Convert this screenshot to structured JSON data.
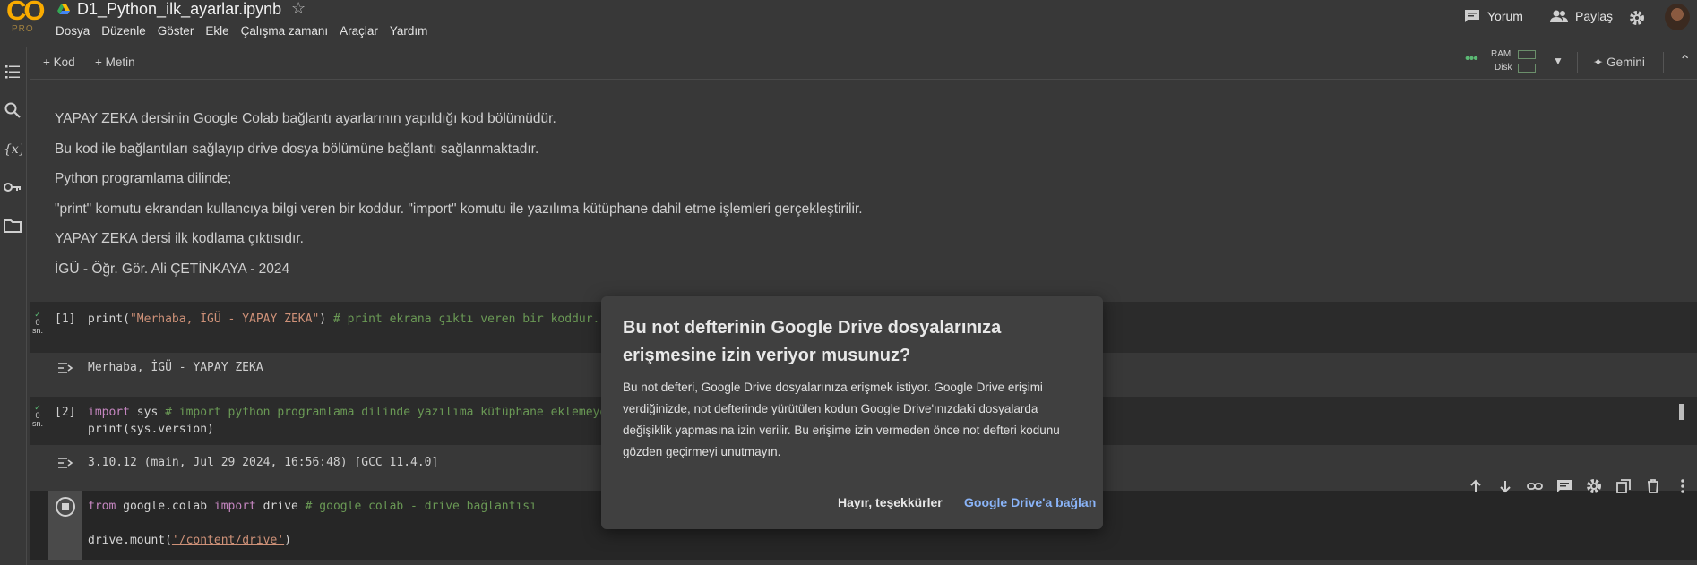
{
  "header": {
    "logo_text": "CO",
    "pro_label": "PRO",
    "notebook_title": "D1_Python_ilk_ayarlar.ipynb",
    "menu": [
      "Dosya",
      "Düzenle",
      "Göster",
      "Ekle",
      "Çalışma zamanı",
      "Araçlar",
      "Yardım"
    ],
    "comment_label": "Yorum",
    "share_label": "Paylaş"
  },
  "toolbar": {
    "add_code_label": "Kod",
    "add_text_label": "Metin",
    "ram_label": "RAM",
    "disk_label": "Disk",
    "gemini_label": "Gemini"
  },
  "text_cell": {
    "lines": [
      "YAPAY ZEKA dersinin Google Colab bağlantı ayarlarının yapıldığı kod bölümüdür.",
      "Bu kod ile bağlantıları sağlayıp drive dosya bölümüne bağlantı sağlanmaktadır.",
      "Python programlama dilinde;",
      "\"print\" komutu ekrandan kullancıya bilgi veren bir koddur. \"import\" komutu ile yazılıma kütüphane dahil etme işlemleri gerçekleştirilir.",
      "YAPAY ZEKA dersi ilk kodlama çıktısıdır.",
      "İGÜ - Öğr. Gör. Ali ÇETİNKAYA - 2024"
    ]
  },
  "cells": [
    {
      "prompt": "[1]",
      "exec_time": "0",
      "exec_unit": "sn.",
      "code": {
        "fn": "print(",
        "str": "\"Merhaba, İGÜ - YAPAY ZEKA\"",
        "close": ")",
        "comment": " # print ekrana çıktı veren bir koddur."
      },
      "output": "Merhaba, İGÜ - YAPAY ZEKA"
    },
    {
      "prompt": "[2]",
      "exec_time": "0",
      "exec_unit": "sn.",
      "code": {
        "kw1": "import",
        "mod": " sys ",
        "comment": "# import python programlama dilinde yazılıma kütüphane eklemeye",
        "line2": "print(sys.version)"
      },
      "output": "3.10.12 (main, Jul 29 2024, 16:56:48) [GCC 11.4.0]"
    },
    {
      "code": {
        "kw_from": "from",
        "mod": " google.colab ",
        "kw_import": "import",
        "name": " drive ",
        "comment": "# google colab - drive bağlantısı",
        "line2_a": "drive.mount(",
        "line2_str": "'/content/drive'",
        "line2_b": ")"
      }
    }
  ],
  "dialog": {
    "title": "Bu not defterinin Google Drive dosyalarınıza erişmesine izin veriyor musunuz?",
    "body": "Bu not defteri, Google Drive dosyalarınıza erişmek istiyor. Google Drive erişimi verdiğinizde, not defterinde yürütülen kodun Google Drive'ınızdaki dosyalarda değişiklik yapmasına izin verilir. Bu erişime izin vermeden önce not defteri kodunu gözden geçirmeyi unutmayın.",
    "cancel_label": "Hayır, teşekkürler",
    "confirm_label": "Google Drive'a bağlan",
    "confirm_color": "#8ab4f8"
  },
  "colors": {
    "background": "#383838",
    "cell_background": "#2b2b2b",
    "keyword": "#c586c0",
    "string": "#ce9178",
    "comment": "#6a9955",
    "success_check": "#5bb974"
  }
}
